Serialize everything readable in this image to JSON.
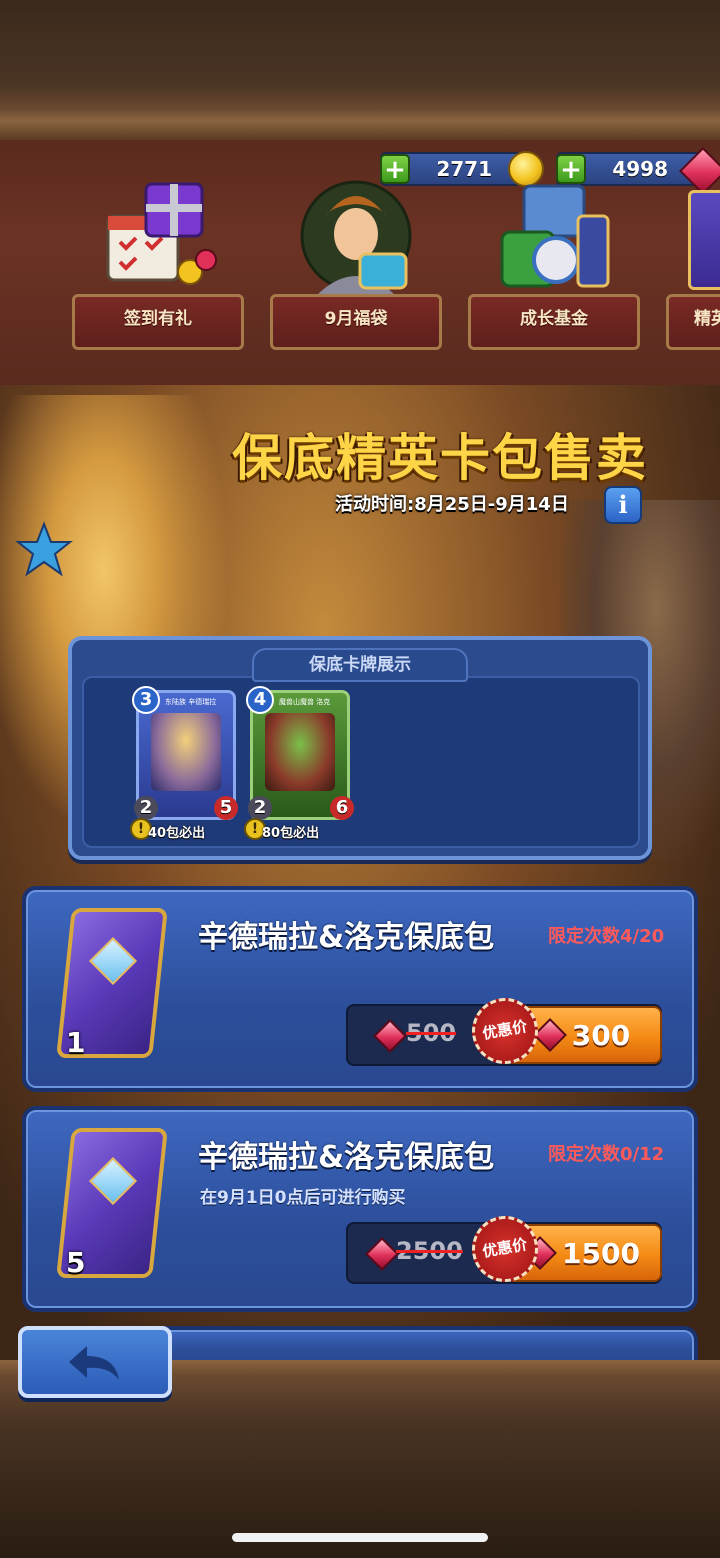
{
  "resources": {
    "coins": "2771",
    "gems": "4998"
  },
  "shop_items": [
    {
      "label": "签到有礼",
      "icon": "gift-calendar-icon"
    },
    {
      "label": "9月福袋",
      "icon": "hero-portrait-icon"
    },
    {
      "label": "成长基金",
      "icon": "gift-boxes-icon"
    },
    {
      "label": "精英",
      "icon": "card-pack-icon"
    }
  ],
  "event": {
    "title": "保底精英卡包售卖",
    "date": "活动时间:8月25日-9月14日",
    "info_icon": "i"
  },
  "showcase": {
    "tab": "保底卡牌展示",
    "cards": [
      {
        "cost": "3",
        "name": "东陆族 辛德瑞拉",
        "attack": "2",
        "health": "5",
        "note": "40包必出",
        "frame_color": "#3a5ab0"
      },
      {
        "cost": "4",
        "name": "魔兽山魔兽 洛克",
        "attack": "2",
        "health": "6",
        "note": "80包必出",
        "frame_color": "#4a8a3a"
      }
    ]
  },
  "offers": [
    {
      "name": "辛德瑞拉&洛克保底包",
      "limit": "限定次数4/20",
      "note": "",
      "pack_count": "1",
      "old_price": "500",
      "discount_label": "优惠价",
      "price": "300"
    },
    {
      "name": "辛德瑞拉&洛克保底包",
      "limit": "限定次数0/12",
      "note": "在9月1日0点后可进行购买",
      "pack_count": "5",
      "old_price": "2500",
      "discount_label": "优惠价",
      "price": "1500"
    }
  ],
  "back_icon": "back-arrow-icon",
  "colors": {
    "gold_title": "#ffd548",
    "limit_red": "#ff5a5a",
    "buy_orange": "#f48a14",
    "panel_blue": "#2c4a8c"
  }
}
